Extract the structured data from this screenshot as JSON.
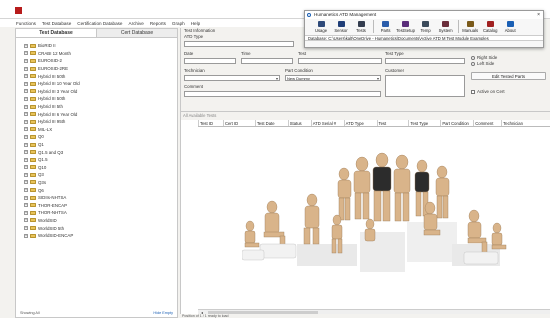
{
  "menu": [
    "Functions",
    "Test Database",
    "Certification Database",
    "Archive",
    "Reports",
    "Graph",
    "Help"
  ],
  "left_tabs": [
    "Test Database",
    "Cert Database"
  ],
  "tree_items": [
    "BioRID II",
    "CRABI 12 Month",
    "EUROSID-2",
    "EUROSID-2RE",
    "Hybrid III 50th",
    "Hybrid III 10 Year Old",
    "Hybrid III 3 Year Old",
    "Hybrid III 50th",
    "Hybrid III 5th",
    "Hybrid III 6 Year Old",
    "Hybrid III 95th",
    "MIL-LX",
    "Q0",
    "Q1",
    "Q1.5 and Q3",
    "Q1.5",
    "Q10",
    "Q3",
    "Q3s",
    "Q6",
    "SIDIIs-NHTSA",
    "THOR-ENCAP",
    "THOR-NHTSA",
    "WorldSID",
    "WorldSID 5th",
    "WorldSID-ENCAP"
  ],
  "left_footer": {
    "left": "Showing All",
    "right": "Hide Empty"
  },
  "form": {
    "test_info": "Test Information",
    "atd_type": "ATD Type",
    "date": "Date",
    "time": "Time",
    "test": "Test",
    "test_type": "Test Type",
    "technician": "Technician",
    "part_condition": "Part Condition",
    "part_condition_value": "New Dummy",
    "customer": "Customer",
    "comment": "Comment",
    "right_side": "Right Side",
    "left_side": "Left Side",
    "edit_tested_parts": "Edit Tested Parts",
    "active_on_cert": "Active on Cert"
  },
  "grid": {
    "title": "All Available Tests",
    "columns": [
      "Test ID",
      "Cert ID",
      "Test Date",
      "Status",
      "ATD Serial #",
      "ATD Type",
      "Test",
      "Test Type",
      "Part Condition",
      "Comment",
      "Technician"
    ]
  },
  "status_text": "Position of  1  / 1  ready to load",
  "dialog": {
    "title": "Humanetics  ATD Management",
    "close": "×",
    "toolbar": [
      {
        "label": "Usage",
        "icon": "usage-icon",
        "color": "#2e4a7a"
      },
      {
        "label": "Sensor",
        "icon": "sensor-icon",
        "color": "#1f3e78"
      },
      {
        "label": "Tests",
        "icon": "tests-icon",
        "color": "#333d4f"
      },
      {
        "label": "Parts",
        "icon": "parts-icon",
        "color": "#2a5caa"
      },
      {
        "label": "TestSetup",
        "icon": "testsetup-icon",
        "color": "#5a2d7a"
      },
      {
        "label": "Temp",
        "icon": "temp-icon",
        "color": "#3a4a5a"
      },
      {
        "label": "System",
        "icon": "system-icon",
        "color": "#6a2d3a"
      },
      {
        "label": "Manuals",
        "icon": "manuals-icon",
        "color": "#7a5a1a"
      },
      {
        "label": "Catalog",
        "icon": "catalog-icon",
        "color": "#a02020"
      },
      {
        "label": "About",
        "icon": "about-icon",
        "color": "#1a5fb4"
      }
    ],
    "db_path": "Database: C:\\Users\\kalt\\OneDrive - Humanetics\\Documents\\Active ATD M Test Module Examples"
  },
  "colors": {
    "accent": "#1a5fb4",
    "folder": "#e8c35a",
    "logo": "#b71c1c",
    "dummy": "#d9b48a"
  }
}
